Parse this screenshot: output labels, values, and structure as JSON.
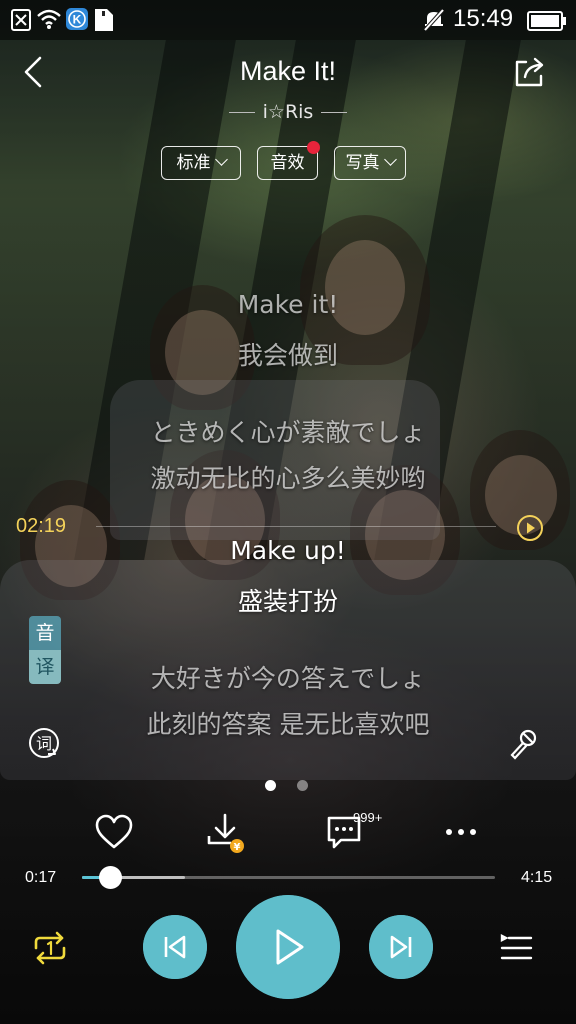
{
  "status_bar": {
    "time": "15:49",
    "icons": [
      "sim-off-icon",
      "wifi-icon",
      "kugou-notification-icon",
      "sd-card-icon",
      "mute-icon",
      "battery-icon"
    ]
  },
  "header": {
    "title": "Make It!",
    "artist": "i☆Ris",
    "back_icon": "back-arrow-icon",
    "share_icon": "share-icon"
  },
  "options": {
    "quality_label": "标准",
    "effect_label": "音效",
    "effect_badge_color": "#e6243b",
    "photo_label": "写真"
  },
  "lyrics": [
    {
      "text": "Make it!",
      "state": "past"
    },
    {
      "text": "我会做到",
      "state": "past"
    },
    {
      "text": "ときめく心が素敵でしょ",
      "state": "past"
    },
    {
      "text": "激动无比的心多么美妙哟",
      "state": "past"
    },
    {
      "text": "Make up!",
      "state": "current"
    },
    {
      "text": "盛装打扮",
      "state": "current"
    },
    {
      "text": "大好きが今の答えでしょ",
      "state": "next"
    },
    {
      "text": "此刻的答案 是无比喜欢吧",
      "state": "next"
    }
  ],
  "lyric_seek": {
    "time": "02:19",
    "color": "#f4d25a",
    "play_icon": "play-circle-icon"
  },
  "translate_toggle": {
    "top": "音",
    "bottom": "译"
  },
  "side_buttons": {
    "lyric_icon": "lyric-icon",
    "mic_icon": "microphone-icon"
  },
  "pager": {
    "count": 2,
    "active": 1
  },
  "actions": {
    "like_icon": "heart-icon",
    "download_icon": "download-icon",
    "comment_icon": "comment-icon",
    "comment_count": "999+",
    "more_icon": "more-icon"
  },
  "progress": {
    "elapsed": "0:17",
    "duration": "4:15",
    "fraction": 0.067,
    "buffered_fraction": 0.25,
    "accent": "#5bc4d6"
  },
  "controls": {
    "repeat_icon": "repeat-icon",
    "prev_icon": "previous-icon",
    "play_icon": "play-icon",
    "next_icon": "next-icon",
    "playlist_icon": "playlist-icon",
    "button_color": "#5fbecb"
  }
}
